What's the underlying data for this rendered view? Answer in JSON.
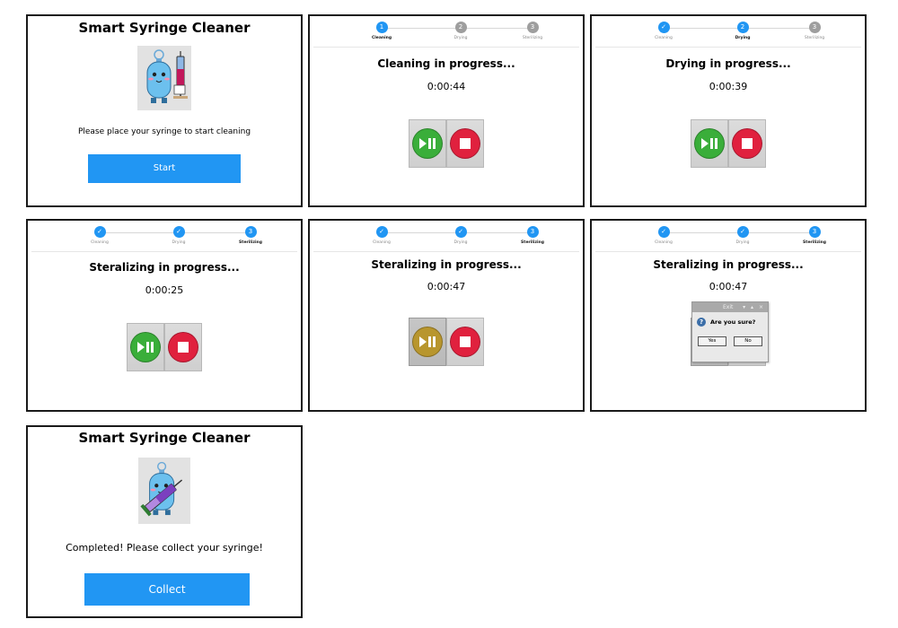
{
  "app_title": "Smart Syringe Cleaner",
  "start_screen": {
    "title": "Smart Syringe Cleaner",
    "instruction": "Please place your syringe to start cleaning",
    "button_label": "Start"
  },
  "complete_screen": {
    "title": "Smart Syringe Cleaner",
    "message": "Completed! Please collect your syringe!",
    "button_label": "Collect"
  },
  "steps": [
    "Cleaning",
    "Drying",
    "Sterilizing"
  ],
  "step_numbers": [
    "1",
    "2",
    "3"
  ],
  "check_glyph": "✓",
  "progress_screens": [
    {
      "status": "Cleaning in progress...",
      "time": "0:00:44",
      "current_step": 1,
      "paused": false
    },
    {
      "status": "Drying in progress...",
      "time": "0:00:39",
      "current_step": 2,
      "paused": false
    },
    {
      "status": "Steralizing in progress...",
      "time": "0:00:25",
      "current_step": 3,
      "paused": false
    },
    {
      "status": "Steralizing in progress...",
      "time": "0:00:47",
      "current_step": 3,
      "paused": true
    },
    {
      "status": "Steralizing in progress...",
      "time": "0:00:47",
      "current_step": 3,
      "paused": true
    }
  ],
  "dialog": {
    "title": "Exit",
    "window_controls": "▾ ▴ ×",
    "question_glyph": "?",
    "question": "Are you sure?",
    "yes_label": "Yes",
    "no_label": "No"
  },
  "colors": {
    "accent": "#2196f3",
    "play_active": "#3aae3a",
    "play_paused": "#b8962e",
    "stop": "#e0213e",
    "pending_step": "#9e9e9e"
  },
  "icons": {
    "play_pause": "play-pause-icon",
    "stop": "stop-icon",
    "check": "check-icon",
    "question": "question-icon",
    "mascot_hold": "mascot-holding-syringe-icon",
    "mascot_done": "mascot-with-syringe-icon"
  }
}
